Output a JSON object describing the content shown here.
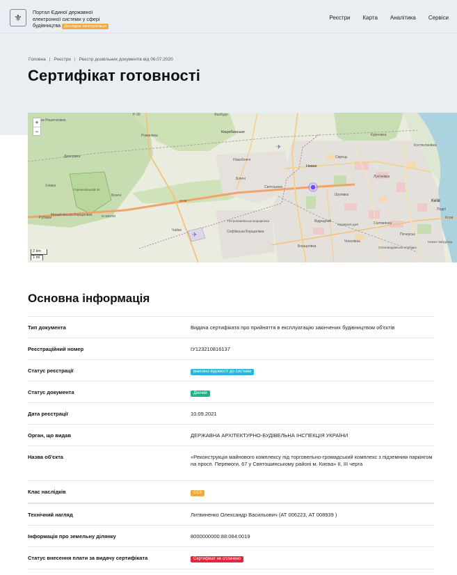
{
  "header": {
    "emblem_glyph": "⚜",
    "portal_line1": "Портал Єдиної державної",
    "portal_line2": "електронної системи у сфері",
    "portal_line3": "будівництва",
    "status_badge": "Дослідна експлуатація",
    "nav": [
      "Реєстри",
      "Карта",
      "Аналітика",
      "Сервіси"
    ]
  },
  "breadcrumb": [
    "Головна",
    "Реєстри",
    "Реєстр дозвільних документів від 06.07.2020"
  ],
  "page_title": "Сертифікат готовності",
  "map": {
    "zoom_in": "+",
    "zoom_out": "−",
    "scale_km": "2 km",
    "scale_mi": "1 mi",
    "labels": {
      "r30": "Р-30",
      "fedorivka": "Фазбудо",
      "sosnivka": "Софіївська Борщагівка",
      "kotsiubynske": "Коцюбинське",
      "romanivka": "Романівка",
      "biliaivka": "Біличі",
      "novobilychi": "Новобіличі",
      "bilychi": "Біличі",
      "nyvky": "Нивки",
      "syrets": "Сирець",
      "kurenivka": "Куренівка",
      "lukianivka": "Лук'янівка",
      "shuliavka": "Шулявка",
      "kyiv": "Київ",
      "podil": "Поділ",
      "kostiantynivka": "Костянтинівка",
      "sviatoshyno": "Святошино",
      "m06": "М-06",
      "o100720": "О-100720",
      "chaiky": "Чайки",
      "petropavlivska": "Петропавлівська Борщагівка",
      "vidradnyi": "Відрадний",
      "karavaievi": "Караваєві дачі",
      "solomianka": "Соломянка",
      "chokolivka": "Чоколівка",
      "pechersk": "Печерськ",
      "oleksandrivska": "Олександрівська слобідка",
      "kyiv_zabrody": "Нижня Забурівка",
      "borshchahivka": "Борщагівка",
      "khlr": "Хлівка",
      "mykhailivska": "Михайлівська Борщагівка",
      "dmytrivka": "Дмитрівка",
      "horenka": "Гореньківський ліс",
      "nova_reshetylivka": "Нова Решетилівка",
      "rubki": "Рубіжки",
      "klov": "Клов"
    }
  },
  "section_title": "Основна інформація",
  "fields": [
    {
      "key": "Тип документа",
      "value": "Видача сертифіката про прийняття в експлуатацію закінчених будівництвом об'єктів"
    },
    {
      "key": "Реєстраційний номер",
      "value": "ІУ123210816137"
    },
    {
      "key": "Статус реєстрації",
      "pill": "внесено відомості до системи",
      "pill_color": "#27b6d9"
    },
    {
      "key": "Статус документа",
      "pill": "Діючий",
      "pill_color": "#1fb28a"
    },
    {
      "key": "Дата реєстрації",
      "value": "10.09.2021"
    },
    {
      "key": "Орган, що видав",
      "value": "ДЕРЖАВНА АРХІТЕКТУРНО-БУДІВЕЛЬНА ІНСПЕКЦІЯ УКРАЇНИ"
    },
    {
      "key": "Назва об'єкта",
      "value": "«Реконструкція майнового комплексу під торговельно-громадський комплекс з підземним паркінгом на просп. Перемоги, 67 у Святошинському районі м. Києва» ІІ, ІІІ черга"
    },
    {
      "key": "Клас наслідків",
      "pill": "СС3",
      "pill_color": "#f2a93b"
    },
    {
      "key": "Технічний нагляд",
      "value": "Литвиненко Олександр Васильович (АТ 006223, АТ 008939 )"
    },
    {
      "key": "Інформація про земельну ділянку",
      "value": "8000000000:88:084:0019"
    },
    {
      "key": "Статус внесення плати за видачу сертифіката",
      "pill": "Сертифікат не сплачено",
      "pill_color": "#e5253b"
    }
  ]
}
